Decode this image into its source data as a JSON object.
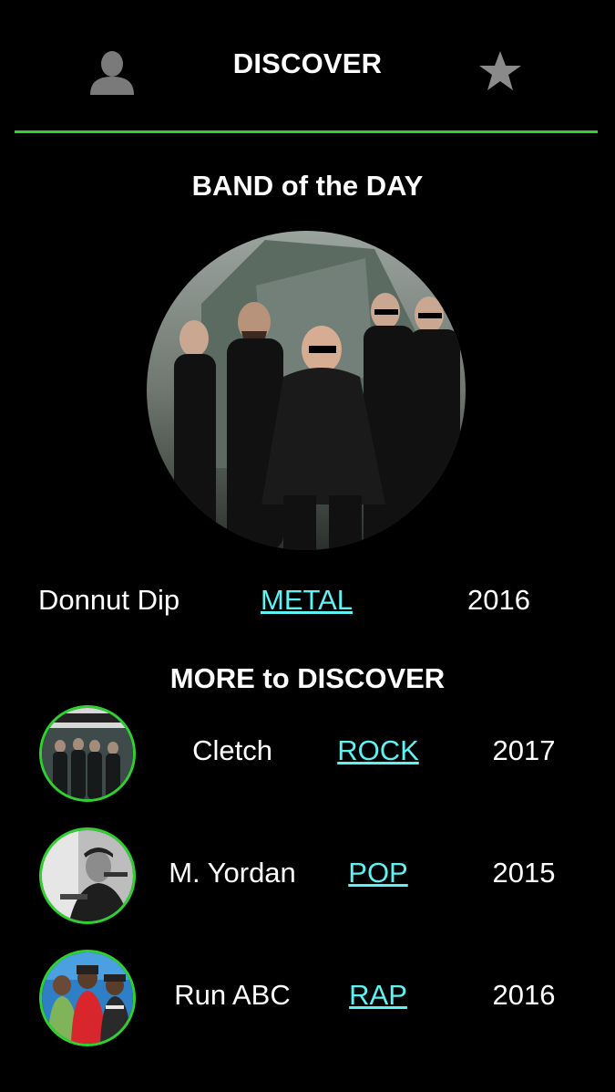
{
  "header": {
    "title": "DISCOVER",
    "profile_icon": "person-icon",
    "favorites_icon": "star-icon"
  },
  "accent_color": "#2fd12f",
  "link_color": "#5ff2f2",
  "band_of_day": {
    "section_title": "BAND of the DAY",
    "name": "Donnut Dip",
    "genre": "METAL",
    "year": "2016"
  },
  "more": {
    "section_title": "MORE to DISCOVER",
    "bands": [
      {
        "name": "Cletch",
        "genre": "ROCK",
        "year": "2017"
      },
      {
        "name": "M. Yordan",
        "genre": "POP",
        "year": "2015"
      },
      {
        "name": "Run ABC",
        "genre": "RAP",
        "year": "2016"
      }
    ]
  }
}
